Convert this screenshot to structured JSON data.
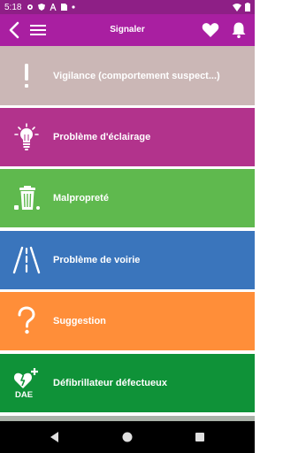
{
  "statusbar": {
    "time": "5:18",
    "icons": [
      "settings-icon",
      "shield-icon",
      "font-icon",
      "sim-card-icon",
      "dot-icon",
      "wifi-icon",
      "battery-icon"
    ]
  },
  "appbar": {
    "title": "Signaler",
    "background": "#a91fa1"
  },
  "categories": [
    {
      "label": "Vigilance (comportement suspect...)",
      "icon": "exclamation-icon",
      "color": "#cbb7b6"
    },
    {
      "label": "Problème d'éclairage",
      "icon": "lightbulb-icon",
      "color": "#b2338c"
    },
    {
      "label": "Malpropreté",
      "icon": "trash-bin-icon",
      "color": "#5fb94e"
    },
    {
      "label": "Problème de voirie",
      "icon": "road-icon",
      "color": "#3a75bc"
    },
    {
      "label": "Suggestion",
      "icon": "question-mark-icon",
      "color": "#ff8e39"
    },
    {
      "label": "Défibrillateur défectueux",
      "icon": "defibrillator-dae-icon",
      "color": "#0f9238",
      "icon_text": "DAE"
    }
  ],
  "navbar": {
    "icons": [
      "nav-back-icon",
      "nav-home-icon",
      "nav-recents-icon"
    ]
  }
}
